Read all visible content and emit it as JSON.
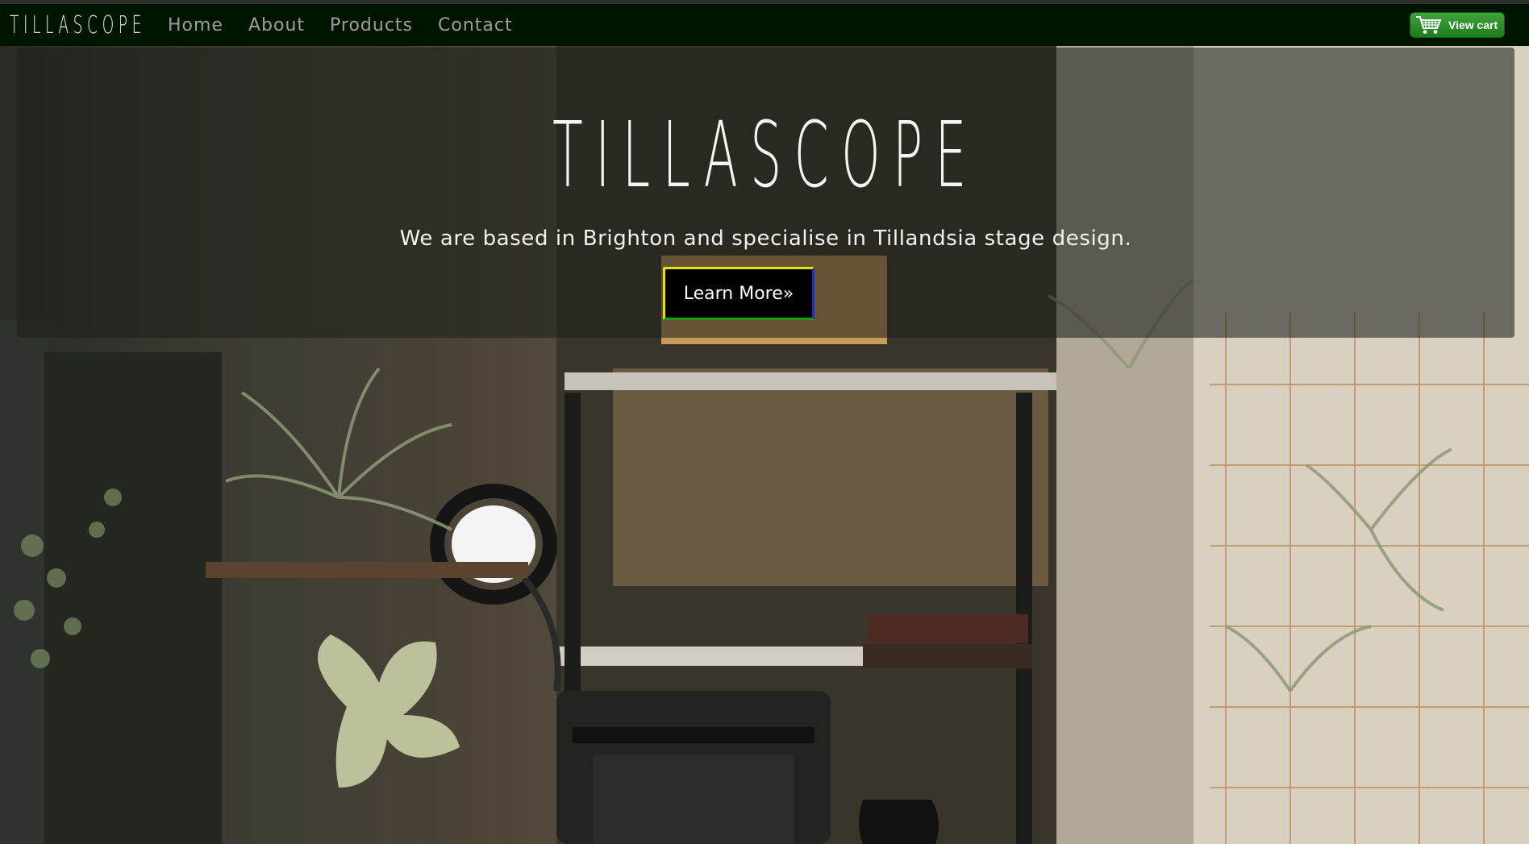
{
  "nav": {
    "brand": "TILLASCOPE",
    "links": [
      "Home",
      "About",
      "Products",
      "Contact"
    ],
    "cart_label": "View cart",
    "cart_icon": "shopping-cart-icon"
  },
  "hero": {
    "title": "TILLASCOPE",
    "subtitle": "We are based in Brighton and specialise in Tillandsia stage design.",
    "button_label": "Learn More»"
  },
  "colors": {
    "navbar_bg": "#001500",
    "nav_link": "#9d9d9d",
    "cart_green": "#2e8f2c",
    "button_bg": "#000000"
  }
}
